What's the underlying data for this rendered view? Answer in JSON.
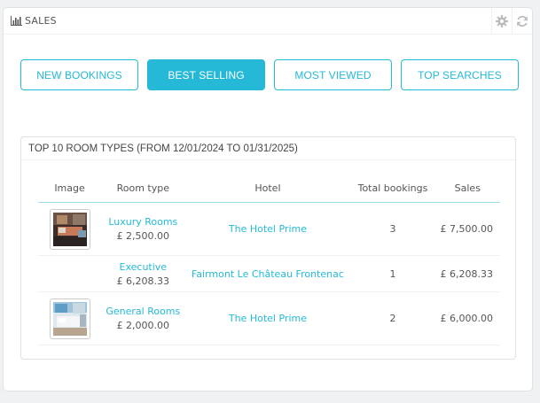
{
  "panel": {
    "title": "SALES"
  },
  "tabs": [
    {
      "label": "NEW BOOKINGS",
      "active": false
    },
    {
      "label": "BEST SELLING",
      "active": true
    },
    {
      "label": "MOST VIEWED",
      "active": false
    },
    {
      "label": "TOP SEARCHES",
      "active": false
    }
  ],
  "section": {
    "title": "TOP 10 ROOM TYPES (FROM 12/01/2024 TO 01/31/2025)"
  },
  "table": {
    "headers": [
      "Image",
      "Room type",
      "Hotel",
      "Total bookings",
      "Sales"
    ],
    "rows": [
      {
        "room_type": "Luxury Rooms",
        "price": "£ 2,500.00",
        "hotel": "The Hotel Prime",
        "bookings": "3",
        "sales": "£ 7,500.00"
      },
      {
        "room_type": "Executive",
        "price": "£ 6,208.33",
        "hotel": "Fairmont Le Château Frontenac",
        "bookings": "1",
        "sales": "£ 6,208.33"
      },
      {
        "room_type": "General Rooms",
        "price": "£ 2,000.00",
        "hotel": "The Hotel Prime",
        "bookings": "2",
        "sales": "£ 6,000.00"
      }
    ]
  },
  "colors": {
    "accent": "#25b9d7",
    "border": "#dde3e6",
    "background": "#eff1f2"
  },
  "icons": {
    "title": "bar-chart-icon",
    "config": "gear-icon",
    "refresh": "refresh-icon"
  }
}
